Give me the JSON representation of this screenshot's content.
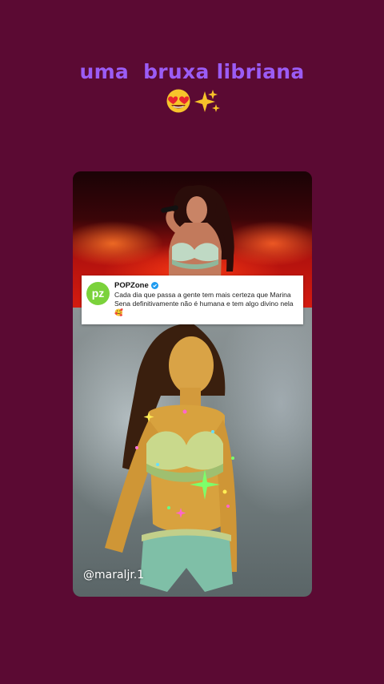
{
  "caption": {
    "line1": "uma  bruxa libriana",
    "emojis": [
      "smiling-face-with-heart-eyes",
      "sparkles"
    ]
  },
  "tweet": {
    "avatar_text": "pz",
    "account_name": "POPZone",
    "verified": true,
    "text": "Cada dia que passa a gente tem mais certeza que Marina Sena definitivamente não é humana e tem algo divino nela 🥰"
  },
  "watermark": {
    "handle": "@maraljr.1"
  },
  "colors": {
    "background": "#5b0a33",
    "caption_text": "#9b5cf5",
    "avatar_green": "#7bd23b",
    "verified_blue": "#1d9bf0",
    "sparkle_green": "#7dff6a"
  }
}
